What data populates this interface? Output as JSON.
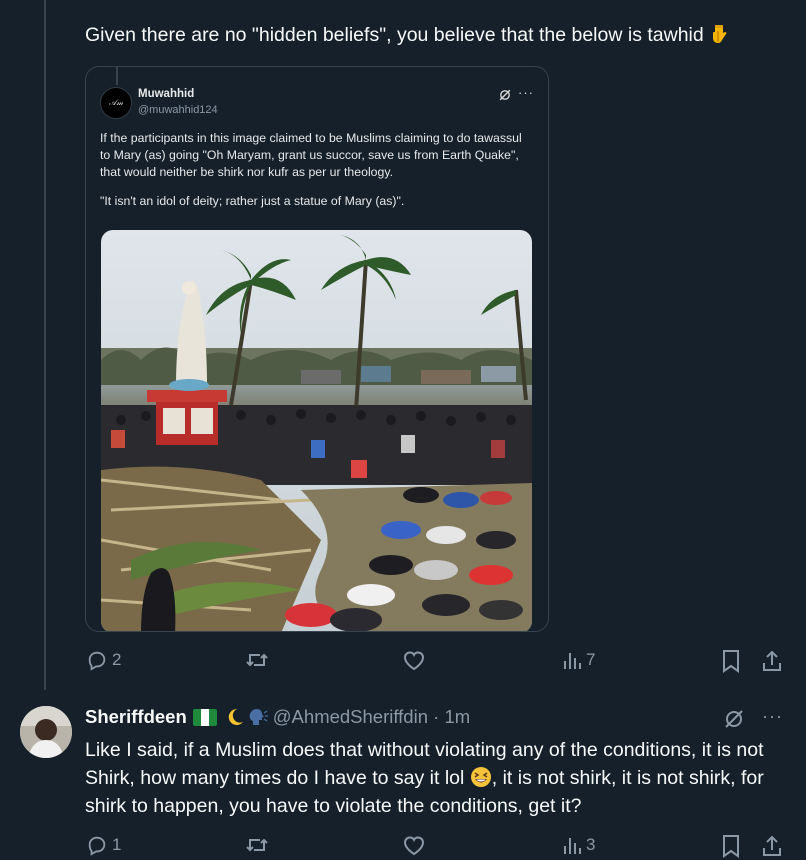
{
  "main_post": {
    "text": "Given there are no \"hidden beliefs\", you believe that the below is tawhid",
    "emoji": "backhand-index-pointing-down"
  },
  "quote": {
    "avatar_text": "𝒜𝓂",
    "name": "Muwahhid",
    "handle": "@muwahhid124",
    "more": "···",
    "paragraph1": "If the participants in this image claimed to be Muslims claiming to do tawassul to Mary (as) going \"Oh Maryam, grant us succor, save us from Earth Quake\", that would neither be shirk nor kufr as per ur theology.",
    "paragraph2": "\"It isn't an idol of deity; rather just a statue of Mary (as)\"."
  },
  "main_actions": {
    "replies": "2",
    "reposts": "",
    "likes": "",
    "views": "7"
  },
  "reply": {
    "name": "Sheriffdeen",
    "handle": "@AhmedSheriffdin · 1m",
    "more": "···",
    "text_part1": "Like I said, if a Muslim does that without violating any of the conditions, it is not Shirk, how many times do I have to say it lol",
    "text_part2": ", it is not shirk, it is not shirk, for shirk to happen, you have to violate the conditions, get it?",
    "actions": {
      "replies": "1",
      "views": "3"
    }
  },
  "colors": {
    "background": "#15202b",
    "text": "#f7f9f9",
    "secondary": "#8b98a5",
    "border": "#38444d"
  }
}
